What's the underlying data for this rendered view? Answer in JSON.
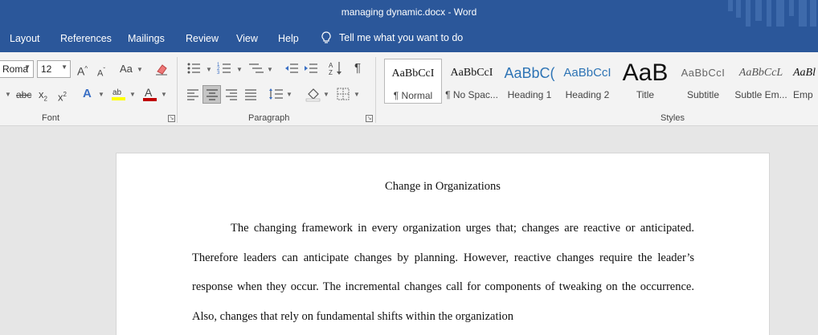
{
  "window": {
    "title": "managing dynamic.docx  -  Word"
  },
  "tabs": [
    "Layout",
    "References",
    "Mailings",
    "Review",
    "View",
    "Help"
  ],
  "tell_me": {
    "placeholder": "Tell me what you want to do",
    "icon": "lightbulb-icon"
  },
  "font_group": {
    "label": "Font",
    "font_name": "Roma",
    "font_size": "12",
    "grow_label": "A",
    "shrink_label": "A",
    "case_label": "Aa",
    "strike_label": "abc",
    "sub_label": "x",
    "sup_label": "x",
    "font_color": "#c00000",
    "highlight_color": "#ffff00"
  },
  "paragraph_group": {
    "label": "Paragraph"
  },
  "styles_group": {
    "label": "Styles",
    "items": [
      {
        "sample": "AaBbCcI",
        "name": "¶ Normal"
      },
      {
        "sample": "AaBbCcI",
        "name": "¶ No Spac..."
      },
      {
        "sample": "AaBbC(",
        "name": "Heading 1"
      },
      {
        "sample": "AaBbCcI",
        "name": "Heading 2"
      },
      {
        "sample": "AaB",
        "name": "Title"
      },
      {
        "sample": "AaBbCcI",
        "name": "Subtitle"
      },
      {
        "sample": "AaBbCcL",
        "name": "Subtle Em..."
      },
      {
        "sample": "AaBl",
        "name": "Emp"
      }
    ]
  },
  "document": {
    "title": "Change in Organizations",
    "paragraph": "The changing framework in every organization urges that; changes are reactive or anticipated. Therefore leaders can anticipate changes by planning. However, reactive changes require the leader’s response when they occur. The incremental changes call for components of tweaking on the occurrence. Also, changes that rely on fundamental shifts within the organization"
  },
  "colors": {
    "title_bar": "#2b579a",
    "ribbon": "#f3f3f3",
    "canvas": "#e6e6e6",
    "heading_blue": "#2e74b5"
  }
}
